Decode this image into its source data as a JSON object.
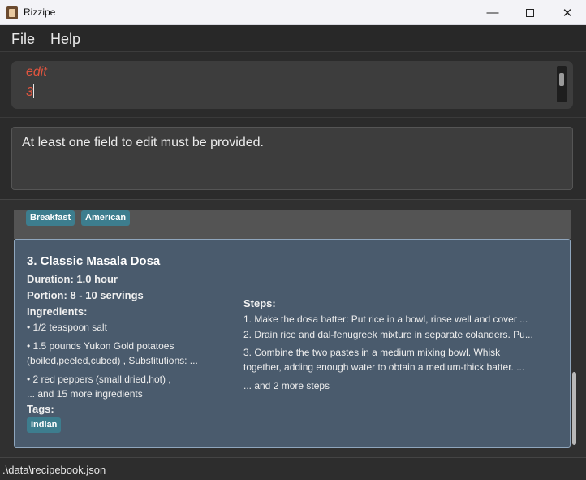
{
  "window": {
    "title": "Rizzipe",
    "minimize_glyph": "—",
    "close_glyph": "✕"
  },
  "menu": {
    "file": "File",
    "help": "Help"
  },
  "command": {
    "line1": "edit",
    "line2": "3"
  },
  "result": {
    "message": "At least one field to edit must be provided."
  },
  "previous_card": {
    "tags": [
      "Breakfast",
      "American"
    ]
  },
  "recipe": {
    "index_title": "3.  Classic Masala Dosa",
    "duration": "Duration: 1.0 hour",
    "portion": "Portion: 8 - 10 servings",
    "ingredients_label": "Ingredients:",
    "ingredients": [
      "• 1/2 teaspoon salt",
      "• 1.5 pounds Yukon Gold potatoes",
      "(boiled,peeled,cubed) , Substitutions: ...",
      "• 2 red peppers (small,dried,hot) ,",
      "... and 15 more ingredients"
    ],
    "tags_label": "Tags:",
    "tags": [
      "Indian"
    ],
    "steps_label": "Steps:",
    "steps": [
      "1. Make the dosa batter: Put rice in a bowl, rinse well and cover ...",
      "2. Drain rice and dal-fenugreek mixture in separate colanders. Pu...",
      "3. Combine the two pastes in a medium mixing bowl. Whisk",
      "together, adding enough water to obtain a medium-thick batter. ...",
      "... and 2 more steps"
    ]
  },
  "status": {
    "path": ".\\data\\recipebook.json"
  }
}
